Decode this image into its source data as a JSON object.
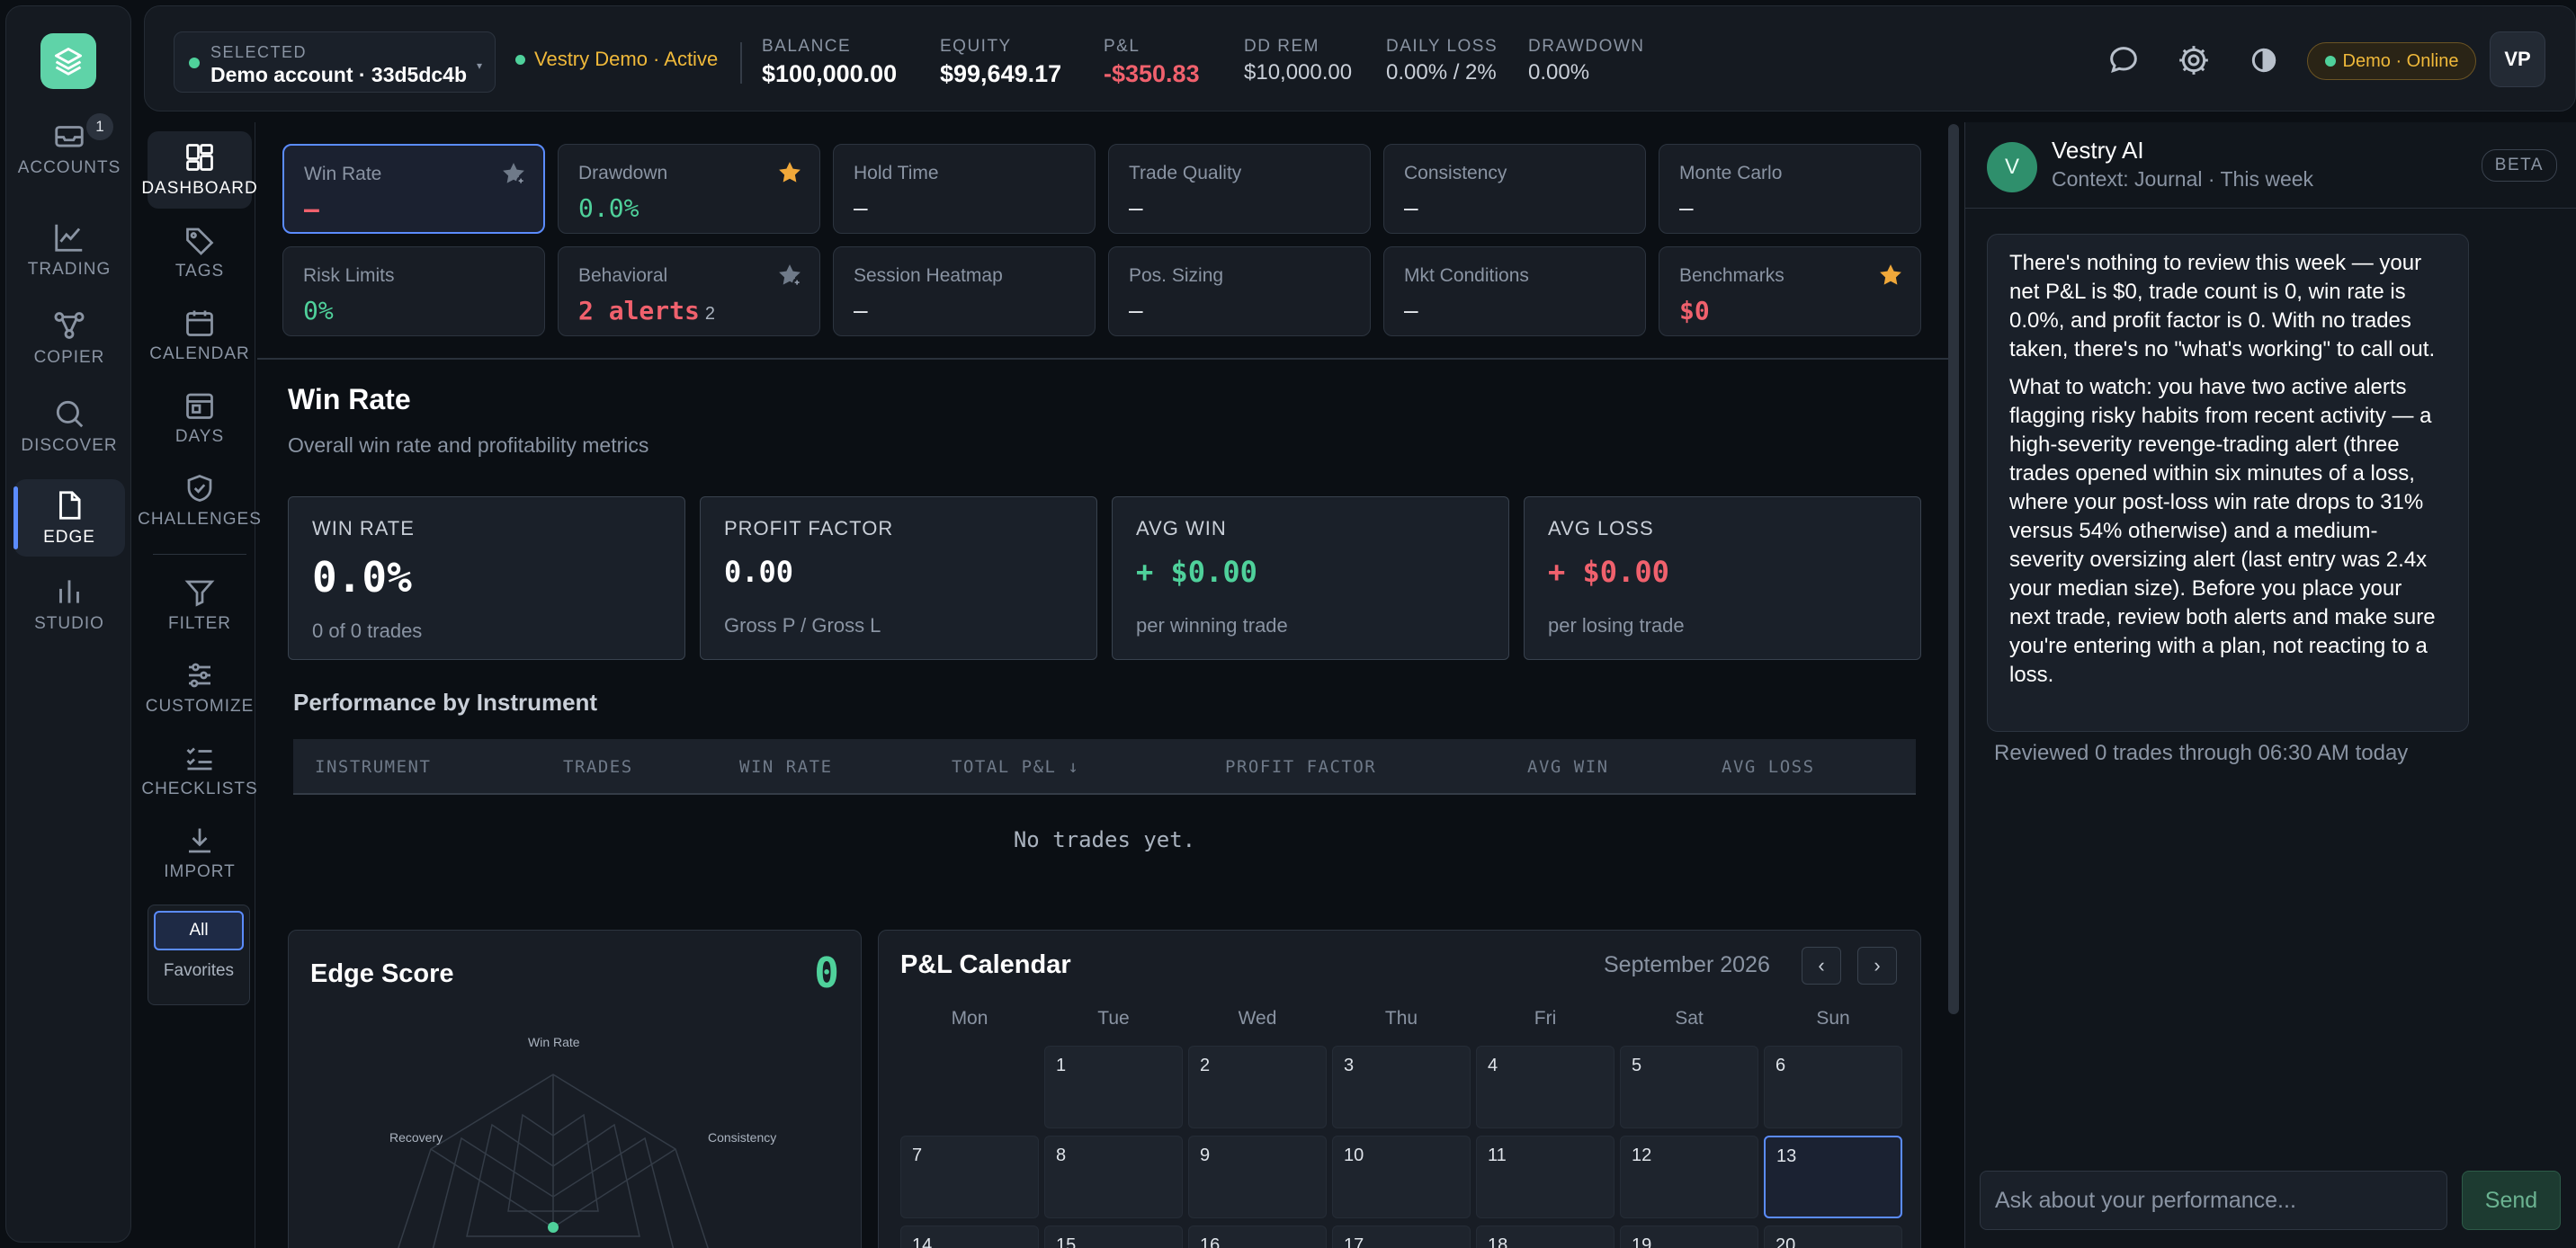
{
  "rail": {
    "items": [
      {
        "label": "ACCOUNTS",
        "icon": "inbox-icon",
        "badge": "1"
      },
      {
        "label": "TRADING",
        "icon": "chart-line-icon"
      },
      {
        "label": "COPIER",
        "icon": "share-nodes-icon"
      },
      {
        "label": "DISCOVER",
        "icon": "search-icon"
      },
      {
        "label": "EDGE",
        "icon": "document-icon",
        "active": true
      },
      {
        "label": "STUDIO",
        "icon": "bar-chart-icon"
      }
    ]
  },
  "topbar": {
    "account": {
      "label": "SELECTED",
      "value": "Demo account · 33d5dc4b",
      "caret": "▾"
    },
    "firm": "Vestry Demo · Active",
    "stats": [
      {
        "label": "BALANCE",
        "value": "$100,000.00"
      },
      {
        "label": "EQUITY",
        "value": "$99,649.17"
      },
      {
        "label": "P&L",
        "value": "-$350.83"
      },
      {
        "label": "DD REM",
        "value": "$10,000.00"
      },
      {
        "label": "DAILY LOSS",
        "value": "0.00% / 2%"
      },
      {
        "label": "DRAWDOWN",
        "value": "0.00%"
      }
    ],
    "mode": "Demo · Online",
    "user_initials": "VP"
  },
  "subnav": {
    "items": [
      {
        "label": "DASHBOARD",
        "icon": "dashboard-icon",
        "active": true
      },
      {
        "label": "TAGS",
        "icon": "tag-icon"
      },
      {
        "label": "CALENDAR",
        "icon": "calendar-icon"
      },
      {
        "label": "DAYS",
        "icon": "calendar-day-icon"
      },
      {
        "label": "CHALLENGES",
        "icon": "shield-check-icon"
      },
      {
        "label": "FILTER",
        "icon": "filter-icon"
      },
      {
        "label": "CUSTOMIZE",
        "icon": "sliders-icon"
      },
      {
        "label": "CHECKLISTS",
        "icon": "checklist-icon"
      },
      {
        "label": "IMPORT",
        "icon": "download-icon"
      }
    ],
    "scope": {
      "all": "All",
      "favorites": "Favorites"
    }
  },
  "cards": [
    {
      "label": "Win Rate",
      "value": "–",
      "style": "red",
      "star": "grey",
      "selected": true
    },
    {
      "label": "Drawdown",
      "value": "0.0%",
      "style": "green",
      "star": "gold"
    },
    {
      "label": "Hold Time",
      "value": "–"
    },
    {
      "label": "Trade Quality",
      "value": "–"
    },
    {
      "label": "Consistency",
      "value": "–"
    },
    {
      "label": "Monte Carlo",
      "value": "–"
    },
    {
      "label": "Risk Limits",
      "value": "0%",
      "style": "green"
    },
    {
      "label": "Behavioral",
      "value": "2 alerts",
      "sub": "2",
      "style": "red",
      "star": "grey"
    },
    {
      "label": "Session Heatmap",
      "value": "–"
    },
    {
      "label": "Pos. Sizing",
      "value": "–"
    },
    {
      "label": "Mkt Conditions",
      "value": "–"
    },
    {
      "label": "Benchmarks",
      "value": "$0",
      "style": "red",
      "star": "gold"
    }
  ],
  "section": {
    "title": "Win Rate",
    "subtitle": "Overall win rate and profitability metrics"
  },
  "metrics": [
    {
      "label": "WIN RATE",
      "value": "0.0%",
      "sub": "0 of 0 trades"
    },
    {
      "label": "PROFIT FACTOR",
      "value": "0.00",
      "sub": "Gross P / Gross L"
    },
    {
      "label": "AVG WIN",
      "value": "+ $0.00",
      "sub": "per winning trade"
    },
    {
      "label": "AVG LOSS",
      "value": "+ $0.00",
      "sub": "per losing trade"
    }
  ],
  "performance": {
    "title": "Performance by Instrument",
    "columns": [
      "INSTRUMENT",
      "TRADES",
      "WIN RATE",
      "TOTAL P&L ↓",
      "PROFIT FACTOR",
      "AVG WIN",
      "AVG LOSS"
    ],
    "empty": "No trades yet."
  },
  "edge": {
    "title": "Edge Score",
    "score": "0",
    "axes": [
      "Win Rate",
      "Consistency",
      "Recovery"
    ]
  },
  "calendar": {
    "title": "P&L Calendar",
    "month": "September 2026",
    "prev": "‹",
    "next": "›",
    "weekdays": [
      "Mon",
      "Tue",
      "Wed",
      "Thu",
      "Fri",
      "Sat",
      "Sun"
    ],
    "days": [
      "1",
      "2",
      "3",
      "4",
      "5",
      "6",
      "7",
      "8",
      "9",
      "10",
      "11",
      "12",
      "13",
      "14",
      "15",
      "16",
      "17",
      "18",
      "19",
      "20"
    ],
    "today": "13"
  },
  "ai": {
    "avatar": "V",
    "name": "Vestry AI",
    "context": "Context: Journal · This week",
    "badge": "BETA",
    "message_p1": "There's nothing to review this week — your net P&L is $0, trade count is 0, win rate is 0.0%, and profit factor is 0. With no trades taken, there's no \"what's working\" to call out.",
    "message_p2": "What to watch: you have two active alerts flagging risky habits from recent activity — a high-severity revenge-trading alert (three trades opened within six minutes of a loss, where your post-loss win rate drops to 31% versus 54% otherwise) and a medium-severity oversizing alert (last entry was 2.4x your median size). Before you place your next trade, review both alerts and make sure you're entering with a plan, not reacting to a loss.",
    "footer": "Reviewed 0 trades through 06:30 AM today",
    "input_placeholder": "Ask about your performance...",
    "send": "Send"
  },
  "colors": {
    "accent_blue": "#5b8cff",
    "positive": "#4fd19b",
    "negative": "#f0616d",
    "warning": "#f0b93a"
  }
}
